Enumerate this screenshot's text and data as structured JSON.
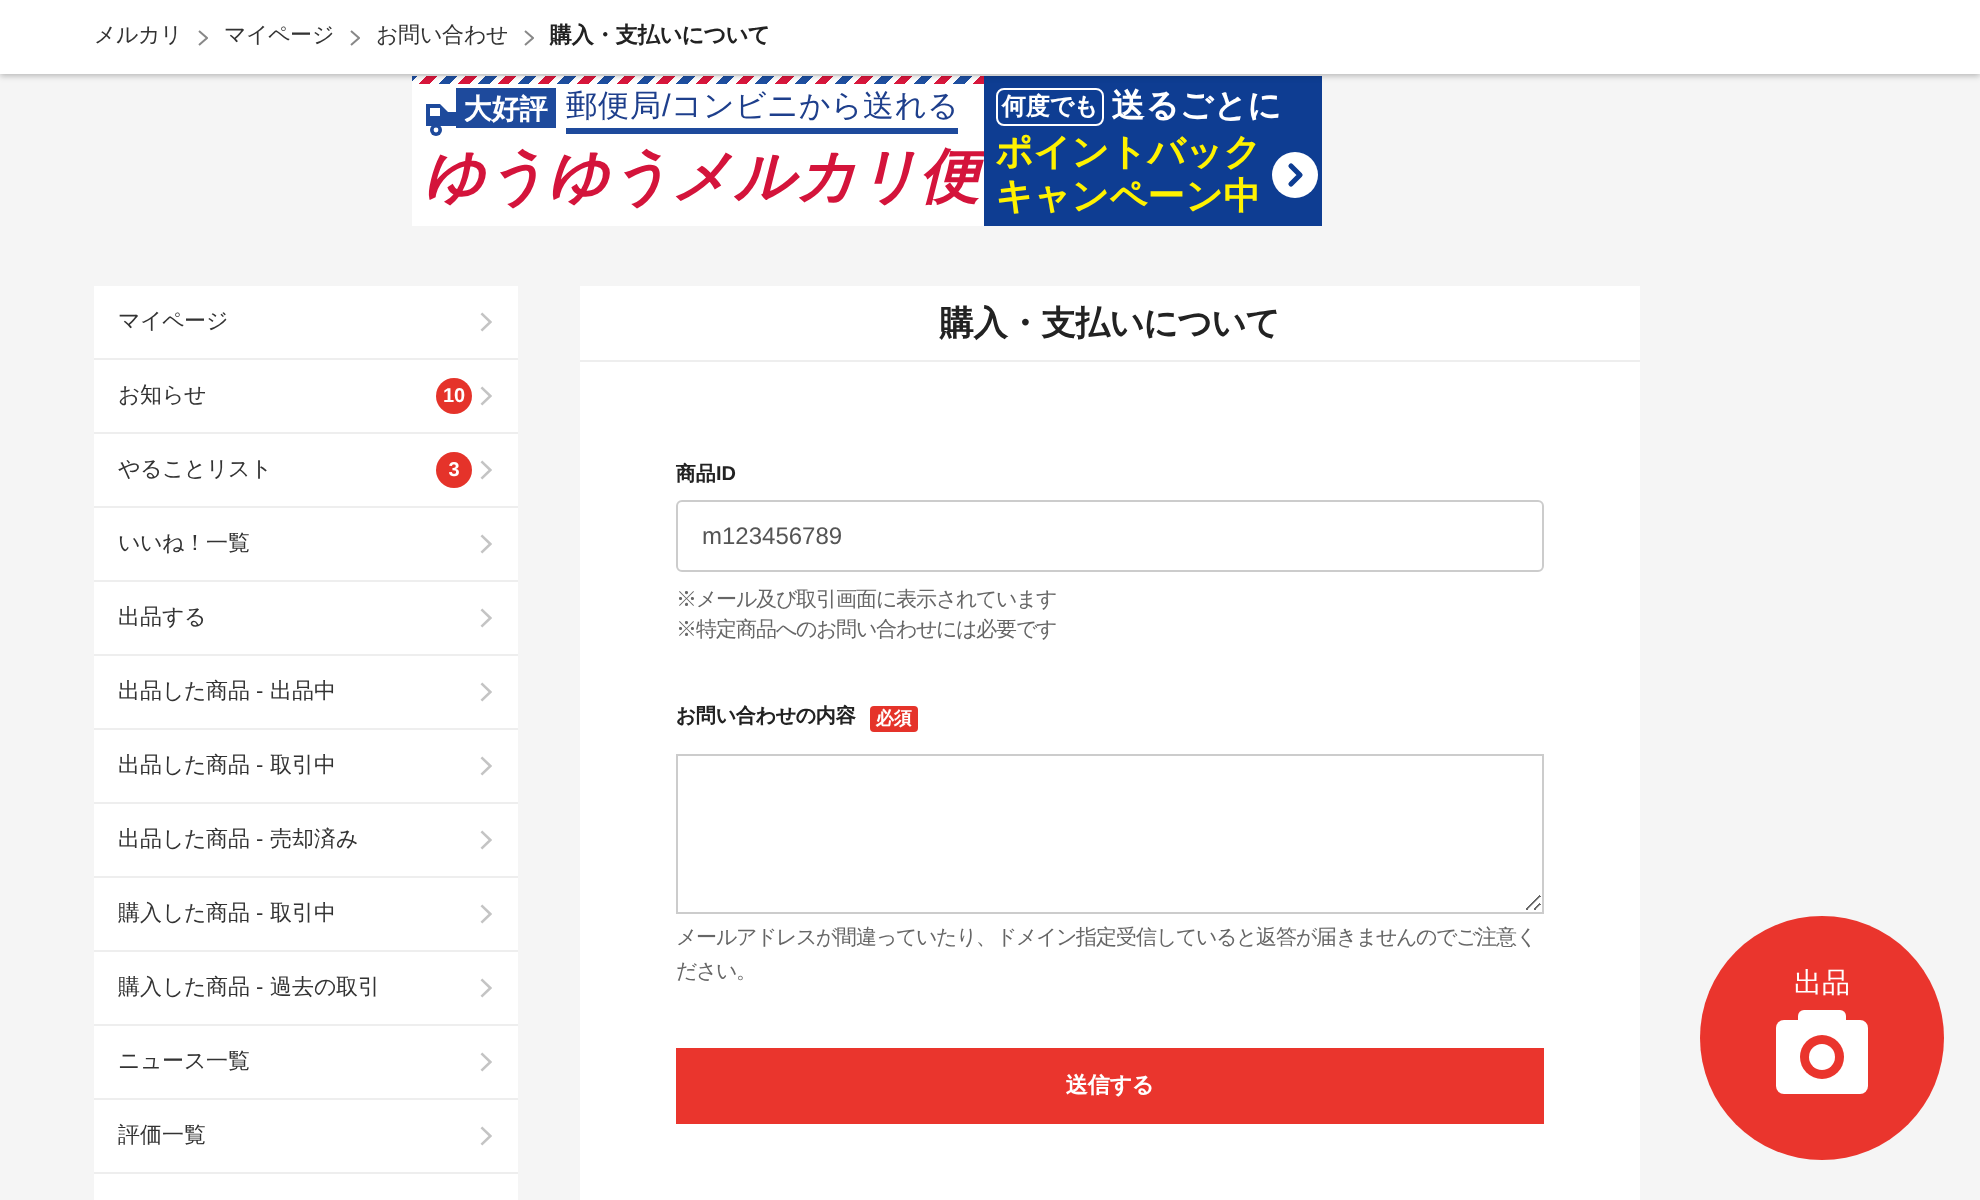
{
  "breadcrumb": [
    {
      "label": "メルカリ",
      "current": false
    },
    {
      "label": "マイページ",
      "current": false
    },
    {
      "label": "お問い合わせ",
      "current": false
    },
    {
      "label": "購入・支払いについて",
      "current": true
    }
  ],
  "banner": {
    "badge": "大好評",
    "tagline": "郵便局/コンビニから送れる",
    "title": "ゆうゆうメルカリ便",
    "tag": "何度でも",
    "subtitle": "送るごとに",
    "headline": [
      "ポイントバック",
      "キャンペーン中"
    ]
  },
  "sidebar": {
    "items": [
      {
        "label": "マイページ"
      },
      {
        "label": "お知らせ",
        "badge": "10"
      },
      {
        "label": "やることリスト",
        "badge": "3"
      },
      {
        "label": "いいね！一覧"
      },
      {
        "label": "出品する"
      },
      {
        "label": "出品した商品 - 出品中"
      },
      {
        "label": "出品した商品 - 取引中"
      },
      {
        "label": "出品した商品 - 売却済み"
      },
      {
        "label": "購入した商品 - 取引中"
      },
      {
        "label": "購入した商品 - 過去の取引"
      },
      {
        "label": "ニュース一覧"
      },
      {
        "label": "評価一覧"
      }
    ]
  },
  "panel": {
    "title": "購入・支払いについて"
  },
  "form": {
    "fields": [
      {
        "kind": "input",
        "label": "商品ID",
        "placeholder": "m123456789",
        "notes": [
          "※メール及び取引画面に表示されています",
          "※特定商品へのお問い合わせには必要です"
        ]
      },
      {
        "kind": "textarea",
        "label": "お問い合わせの内容",
        "tag": "必須",
        "notes": [
          "メールアドレスが間違っていたり、ドメイン指定受信していると返答が届きませんのでご注意ください。"
        ]
      }
    ],
    "submit": "送信する"
  },
  "fab": {
    "label": "出品"
  }
}
